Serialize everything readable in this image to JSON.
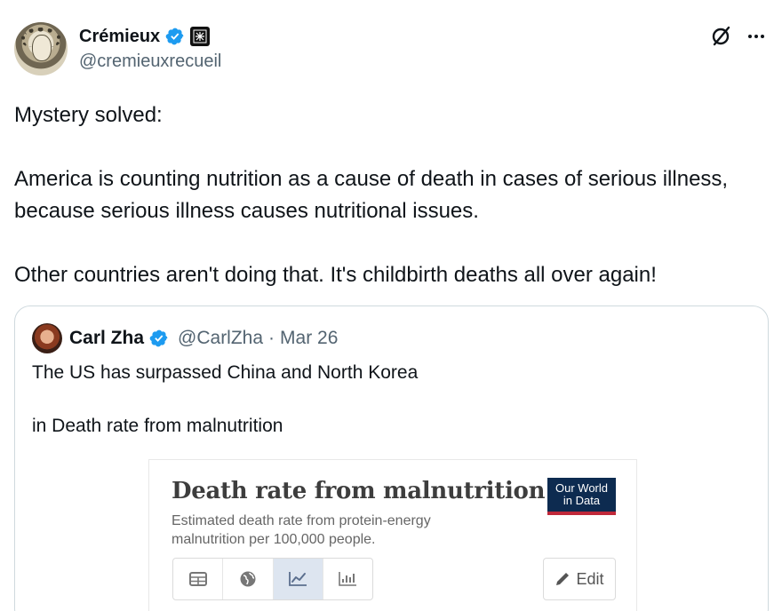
{
  "tweet": {
    "author_name": "Crémieux",
    "author_handle": "@cremieuxrecueil",
    "text_lines": [
      "Mystery solved:",
      "America is counting nutrition as a cause of death in cases of serious illness, because serious illness causes nutritional issues.",
      "Other countries aren't doing that. It's childbirth deaths all over again!"
    ]
  },
  "quote": {
    "author_name": "Carl Zha",
    "author_handle": "@CarlZha",
    "separator": "·",
    "date": "Mar 26",
    "text_lines": [
      "The US has surpassed China and North Korea",
      "in Death rate from malnutrition"
    ]
  },
  "chart_card": {
    "title": "Death rate from malnutrition",
    "subtitle": "Estimated death rate from protein-energy malnutrition per 100,000 people.",
    "logo_line1": "Our World",
    "logo_line2": "in Data",
    "tabs": [
      "table-icon",
      "globe-icon",
      "line-chart-icon",
      "bar-chart-icon"
    ],
    "active_tab": "line-chart-icon",
    "edit_label": "Edit"
  },
  "colors": {
    "verified_blue": "#1d9bf0",
    "handle_gray": "#536471",
    "owid_navy": "#0d2b50",
    "owid_red": "#c0283a"
  }
}
